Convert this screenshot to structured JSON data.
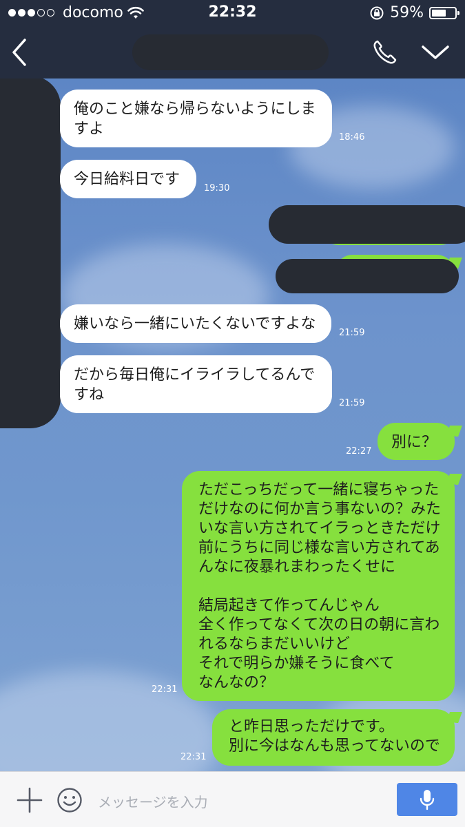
{
  "status_bar": {
    "carrier": "docomo",
    "time": "22:32",
    "battery": "59%",
    "signal_dots_filled": 3,
    "signal_dots_total": 5
  },
  "header": {
    "back_icon": "chevron-left-icon",
    "call_icon": "phone-icon",
    "menu_icon": "chevron-down-icon"
  },
  "messages": [
    {
      "side": "in",
      "text": "俺のこと嫌なら帰らないようにしま\nすよ",
      "time": "18:46"
    },
    {
      "side": "in",
      "text": "今日給料日です",
      "time": "19:30"
    },
    {
      "side": "out",
      "text": "",
      "time": "",
      "redacted": true
    },
    {
      "side": "out",
      "text": "",
      "time": "",
      "redacted": true
    },
    {
      "side": "in",
      "text": "嫌いなら一緒にいたくないですよな",
      "time": "21:59"
    },
    {
      "side": "in",
      "text": "だから毎日俺にイライラしてるんで\nすね",
      "time": "21:59"
    },
    {
      "side": "out",
      "text": "別に？",
      "time": "22:27"
    },
    {
      "side": "out",
      "text": "ただこっちだって一緒に寝ちゃった\nだけなのに何か言う事ないの？みた\nいな言い方されてイラっときただけ\n前にうちに同じ様な言い方されてあ\nんなに夜暴れまわったくせに\n\n結局起きて作ってんじゃん\n全く作ってなくて次の日の朝に言わ\nれるならまだいいけど\nそれで明らか嫌そうに食べて\nなんなの？",
      "time": "22:31"
    },
    {
      "side": "out",
      "text": "と昨日思っただけです。\n別に今はなんも思ってないので",
      "time": "22:31"
    }
  ],
  "input": {
    "placeholder": "メッセージを入力"
  },
  "colors": {
    "header_bg": "#252d3f",
    "outgoing_bubble": "#86e03e",
    "incoming_bubble": "#ffffff",
    "mic_button": "#4f86e6"
  }
}
